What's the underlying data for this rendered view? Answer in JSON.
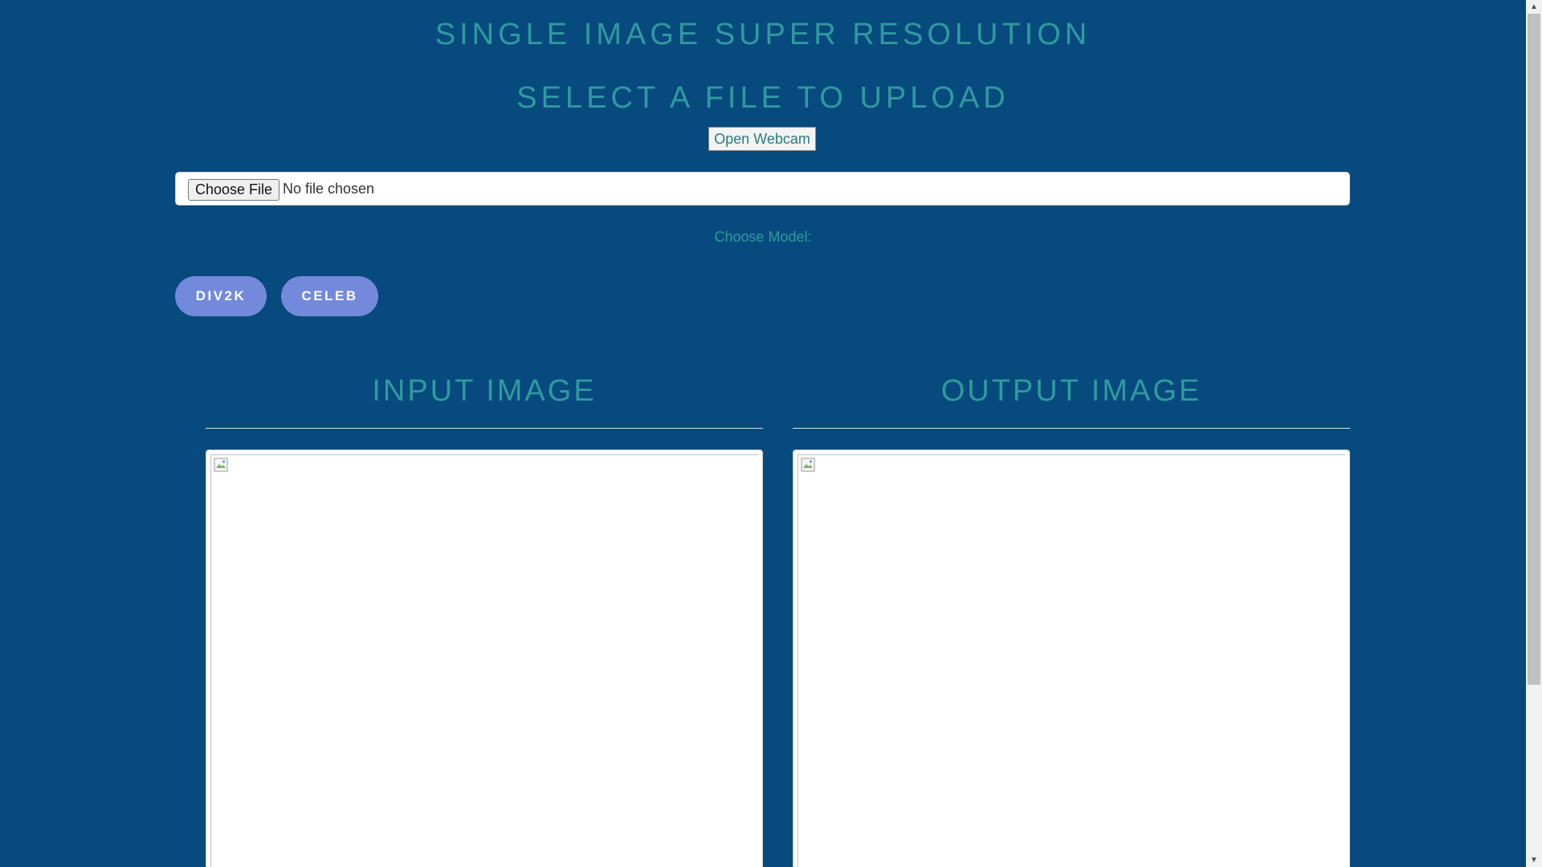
{
  "header": {
    "title": "SINGLE IMAGE SUPER RESOLUTION",
    "subtitle": "SELECT A FILE TO UPLOAD"
  },
  "webcam": {
    "button_label": "Open Webcam"
  },
  "file_input": {
    "button_label": "Choose File",
    "status_text": "No file chosen"
  },
  "model": {
    "label": "Choose Model:",
    "options": [
      "DIV2K",
      "CELEB"
    ]
  },
  "panels": {
    "input_title": "INPUT IMAGE",
    "output_title": "OUTPUT IMAGE"
  },
  "colors": {
    "background": "#074a7d",
    "accent_text": "#2f9aa0",
    "model_button": "#7389dc"
  },
  "icons": {
    "broken_image": "broken-image-icon",
    "scroll_up": "chevron-up-icon",
    "scroll_down": "chevron-down-icon"
  }
}
